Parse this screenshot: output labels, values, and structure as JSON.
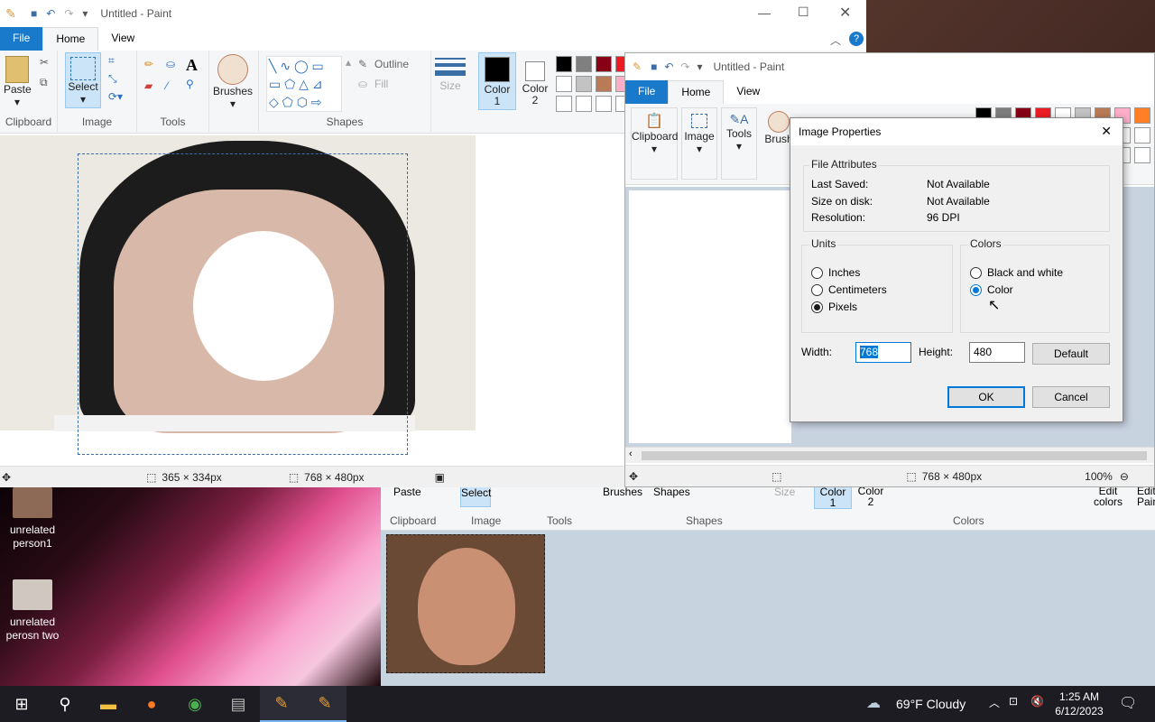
{
  "desktop": {
    "icons": [
      {
        "label_line1": "unrelated",
        "label_line2": "person1"
      },
      {
        "label_line1": "unrelated",
        "label_line2": "perosn two"
      }
    ]
  },
  "paint_main": {
    "title": "Untitled - Paint",
    "menu": {
      "file": "File",
      "home": "Home",
      "view": "View"
    },
    "groups": {
      "clipboard": "Clipboard",
      "image": "Image",
      "tools": "Tools",
      "shapes": "Shapes"
    },
    "buttons": {
      "paste": "Paste",
      "select": "Select",
      "brushes": "Brushes",
      "outline": "Outline",
      "fill": "Fill",
      "size": "Size",
      "color1": "Color",
      "color1_num": "1",
      "color2": "Color",
      "color2_num": "2"
    },
    "status": {
      "selection_size": "365 × 334px",
      "image_size": "768 × 480px"
    }
  },
  "paint_second": {
    "title": "Untitled - Paint",
    "menu": {
      "file": "File",
      "home": "Home",
      "view": "View"
    },
    "buttons": {
      "clipboard": "Clipboard",
      "image": "Image",
      "tools": "Tools",
      "brushes": "Brush"
    },
    "status": {
      "image_size": "768 × 480px",
      "zoom": "100%"
    }
  },
  "paint_third": {
    "buttons": {
      "paste": "Paste",
      "select": "Select",
      "brushes": "Brushes",
      "shapes": "Shapes",
      "size": "Size",
      "color1": "Color",
      "color1_num": "1",
      "color2": "Color",
      "color2_num": "2",
      "edit_colors_1": "Edit",
      "edit_colors_2": "colors",
      "edit_paint_1": "Edit",
      "edit_paint_2": "Pain"
    },
    "groups": {
      "clipboard": "Clipboard",
      "image": "Image",
      "tools": "Tools",
      "shapes": "Shapes",
      "colors": "Colors"
    }
  },
  "dialog": {
    "title": "Image Properties",
    "file_attributes": {
      "legend": "File Attributes",
      "last_saved_label": "Last Saved:",
      "last_saved_value": "Not Available",
      "size_label": "Size on disk:",
      "size_value": "Not Available",
      "resolution_label": "Resolution:",
      "resolution_value": "96 DPI"
    },
    "units": {
      "legend": "Units",
      "inches": "Inches",
      "centimeters": "Centimeters",
      "pixels": "Pixels",
      "selected": "pixels"
    },
    "colors": {
      "legend": "Colors",
      "bw": "Black and white",
      "color": "Color",
      "selected": "color"
    },
    "width_label": "Width:",
    "width_value": "768",
    "height_label": "Height:",
    "height_value": "480",
    "default": "Default",
    "ok": "OK",
    "cancel": "Cancel"
  },
  "taskbar": {
    "weather": "69°F  Cloudy",
    "time": "1:25 AM",
    "date": "6/12/2023"
  },
  "palette_colors": [
    "#000000",
    "#7f7f7f",
    "#880015",
    "#ed1c24",
    "#ffffff",
    "#c3c3c3",
    "#b97a57",
    "#ffaec9",
    "#ff7f27",
    "#fff200",
    "#22b14c",
    "#00a2e8",
    "#3f48cc",
    "#a349a4"
  ]
}
